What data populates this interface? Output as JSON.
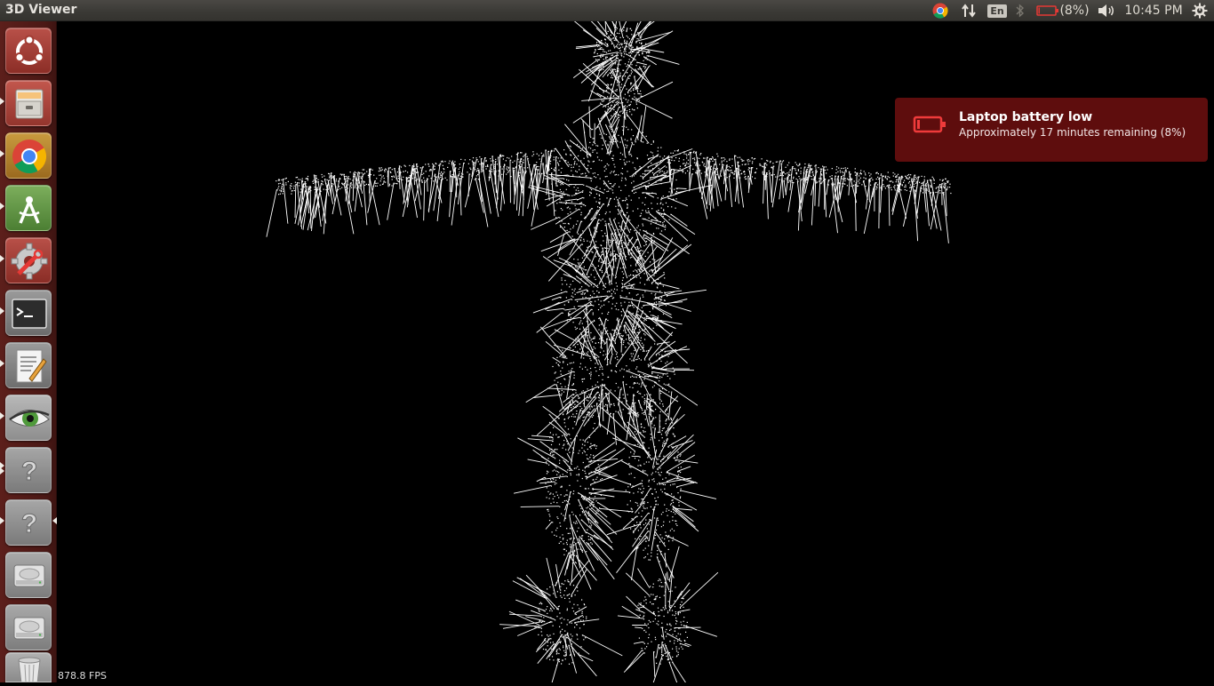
{
  "top_panel": {
    "app_title": "3D Viewer",
    "tray": {
      "chrome_icon": "chrome-icon",
      "network_icon": "network-updown-icon",
      "keyboard_layout": "En",
      "bluetooth_icon": "bluetooth-icon",
      "battery_icon": "battery-low-icon",
      "battery_percent": "(8%)",
      "battery_level": 0.08,
      "volume_icon": "volume-icon",
      "clock": "10:45 PM",
      "session_icon": "gear-power-icon"
    }
  },
  "launcher": {
    "items": [
      {
        "name": "dash-home",
        "icon": "ubuntu-logo-icon",
        "running": false
      },
      {
        "name": "files",
        "icon": "file-cabinet-icon",
        "running": true
      },
      {
        "name": "chrome",
        "icon": "chrome-icon",
        "running": true
      },
      {
        "name": "android-studio",
        "icon": "android-studio-icon",
        "running": true
      },
      {
        "name": "system-settings",
        "icon": "settings-wrench-icon",
        "running": true
      },
      {
        "name": "terminal",
        "icon": "terminal-icon",
        "running": true
      },
      {
        "name": "text-editor",
        "icon": "text-editor-icon",
        "running": true
      },
      {
        "name": "image-viewer",
        "icon": "eye-icon",
        "running": true
      },
      {
        "name": "unknown-app-1",
        "icon": "question-mark-icon",
        "running": true
      },
      {
        "name": "unknown-app-2",
        "icon": "question-mark-icon",
        "running": true,
        "focused": true
      },
      {
        "name": "drive-1",
        "icon": "hard-drive-icon",
        "running": false
      },
      {
        "name": "drive-2",
        "icon": "hard-drive-icon",
        "running": false
      },
      {
        "name": "trash",
        "icon": "trash-icon",
        "running": false
      }
    ]
  },
  "viewer": {
    "fps_text": "878.8 FPS",
    "model": "human-figure-point-cloud-with-normals"
  },
  "notification": {
    "icon": "battery-empty-icon",
    "title": "Laptop battery low",
    "body": "Approximately 17 minutes remaining (8%)",
    "color": "#5e0d0d"
  },
  "colors": {
    "panel": "#3c3b37",
    "launcher": "#4f1a17",
    "background": "#000000",
    "points": "#ffffff",
    "battery_warning": "#e53935"
  }
}
